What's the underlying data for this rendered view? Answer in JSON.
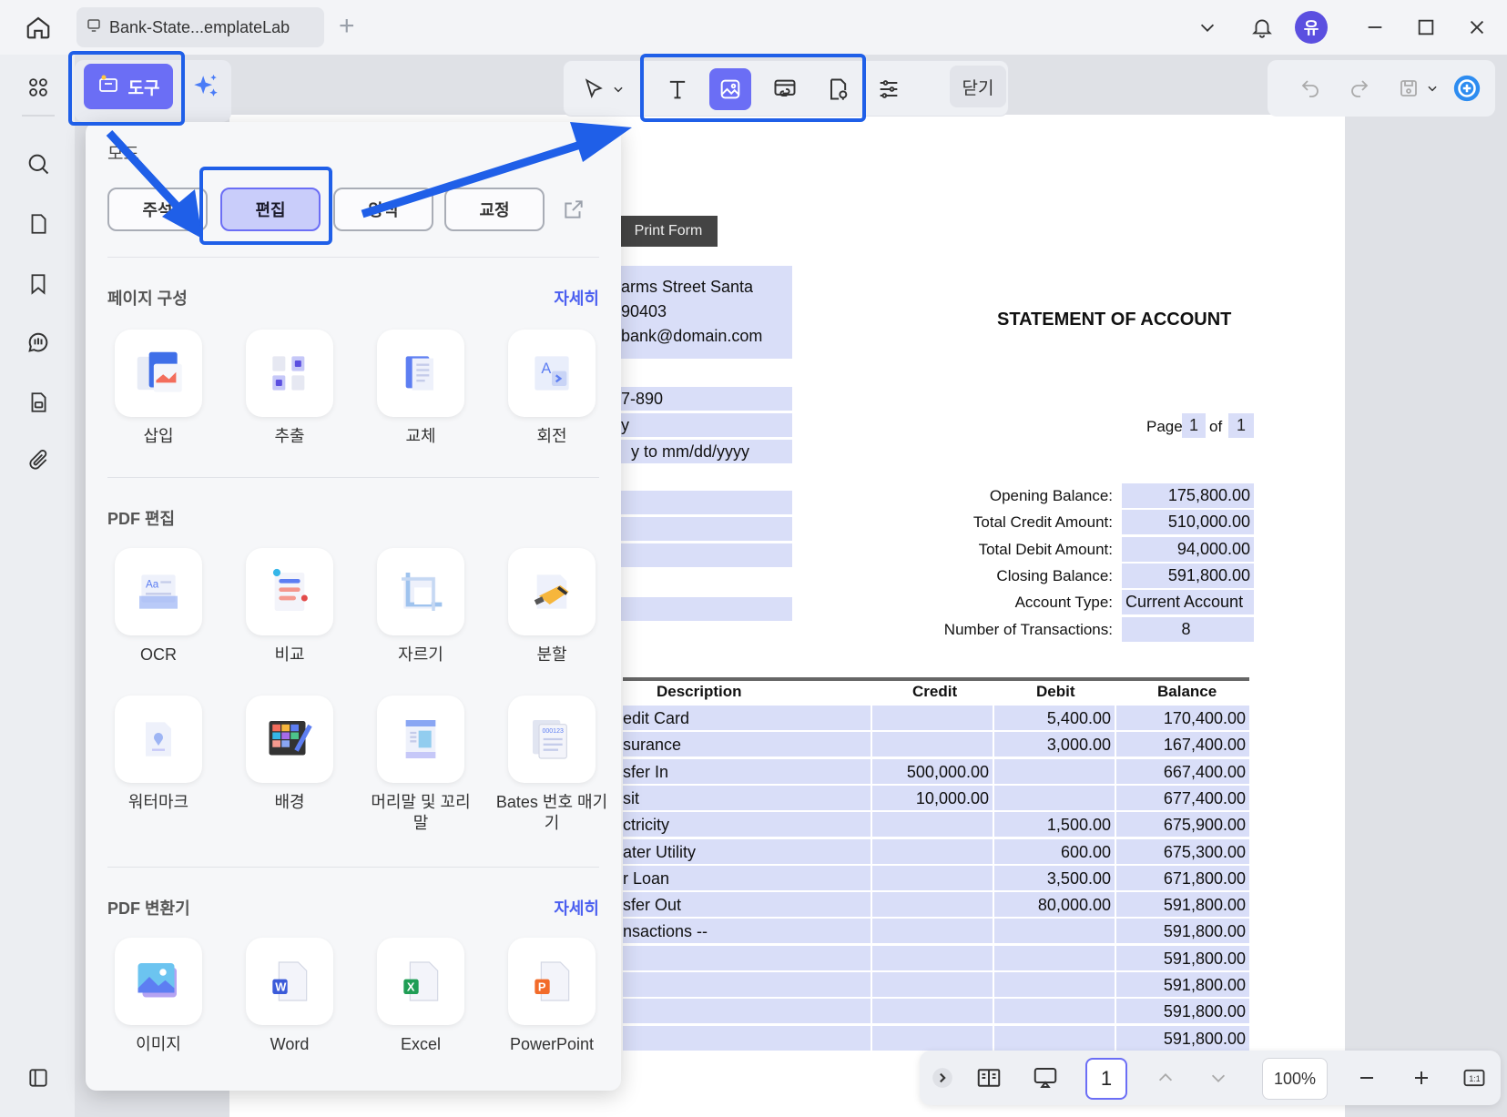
{
  "window": {
    "tab_title": "Bank-State...emplateLab",
    "avatar_initial": "유"
  },
  "toolbar": {
    "tools_label": "도구",
    "close_label": "닫기"
  },
  "panel": {
    "mode_label": "모드",
    "modes": [
      "주석",
      "편집",
      "양식",
      "교정"
    ],
    "active_mode": "편집",
    "page_section": {
      "title": "페이지 구성",
      "more": "자세히",
      "items": [
        "삽입",
        "추출",
        "교체",
        "회전"
      ]
    },
    "edit_section": {
      "title": "PDF 편집",
      "items": [
        "OCR",
        "비교",
        "자르기",
        "분할",
        "워터마크",
        "배경",
        "머리말 및 꼬리말",
        "Bates 번호 매기기"
      ]
    },
    "convert_section": {
      "title": "PDF 변환기",
      "more": "자세히",
      "items": [
        "이미지",
        "Word",
        "Excel",
        "PowerPoint"
      ]
    }
  },
  "document": {
    "print_form": "Print Form",
    "address_lines": [
      "arms Street Santa",
      "90403",
      "bank@domain.com"
    ],
    "info_lines": [
      "7-890",
      "y",
      "y to mm/dd/yyyy"
    ],
    "title": "STATEMENT OF ACCOUNT",
    "page_label": "Page",
    "page_current": "1",
    "page_of": "of",
    "page_total": "1",
    "summary": [
      {
        "label": "Opening Balance:",
        "value": "175,800.00"
      },
      {
        "label": "Total Credit Amount:",
        "value": "510,000.00"
      },
      {
        "label": "Total Debit Amount:",
        "value": "94,000.00"
      },
      {
        "label": "Closing Balance:",
        "value": "591,800.00"
      },
      {
        "label": "Account Type:",
        "value": "Current Account"
      },
      {
        "label": "Number of Transactions:",
        "value": "8"
      }
    ],
    "table_headers": [
      "Description",
      "Credit",
      "Debit",
      "Balance"
    ],
    "rows": [
      {
        "desc": "edit Card",
        "credit": "",
        "debit": "5,400.00",
        "balance": "170,400.00"
      },
      {
        "desc": "surance",
        "credit": "",
        "debit": "3,000.00",
        "balance": "167,400.00"
      },
      {
        "desc": "sfer In",
        "credit": "500,000.00",
        "debit": "",
        "balance": "667,400.00"
      },
      {
        "desc": "sit",
        "credit": "10,000.00",
        "debit": "",
        "balance": "677,400.00"
      },
      {
        "desc": "ctricity",
        "credit": "",
        "debit": "1,500.00",
        "balance": "675,900.00"
      },
      {
        "desc": "ater Utility",
        "credit": "",
        "debit": "600.00",
        "balance": "675,300.00"
      },
      {
        "desc": "r Loan",
        "credit": "",
        "debit": "3,500.00",
        "balance": "671,800.00"
      },
      {
        "desc": "sfer Out",
        "credit": "",
        "debit": "80,000.00",
        "balance": "591,800.00"
      },
      {
        "desc": "nsactions --",
        "credit": "",
        "debit": "",
        "balance": "591,800.00"
      },
      {
        "desc": "",
        "credit": "",
        "debit": "",
        "balance": "591,800.00"
      },
      {
        "desc": "",
        "credit": "",
        "debit": "",
        "balance": "591,800.00"
      },
      {
        "desc": "",
        "credit": "",
        "debit": "",
        "balance": "591,800.00"
      },
      {
        "desc": "",
        "credit": "",
        "debit": "",
        "balance": "591,800.00"
      }
    ]
  },
  "bottom": {
    "page_number": "1",
    "zoom": "100%"
  },
  "colors": {
    "accent": "#6b6ef5",
    "highlight": "#1f5fe8",
    "field": "#d9def8"
  }
}
